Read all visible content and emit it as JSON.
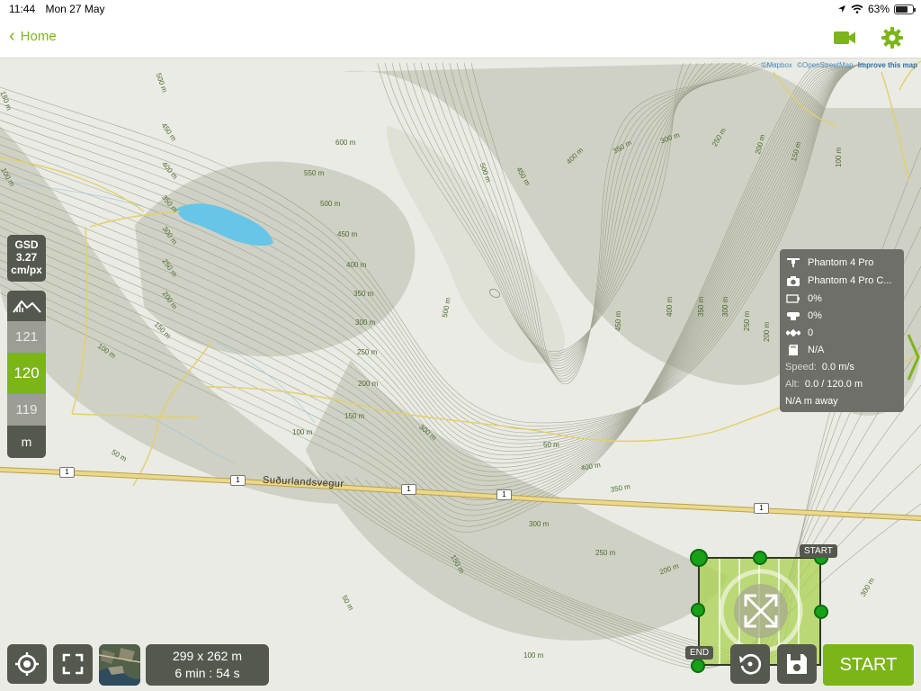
{
  "status_bar": {
    "time": "11:44",
    "date": "Mon 27 May",
    "battery": "63%"
  },
  "top_bar": {
    "back_label": "Home"
  },
  "map": {
    "attribution": {
      "mapbox": "©Mapbox",
      "osm": "©OpenStreetMap",
      "improve": "Improve this map"
    },
    "road_name": "Suðurlandsvegur",
    "road_shields": [
      "1",
      "1",
      "1",
      "1",
      "1"
    ],
    "contour_labels": [
      "500 m",
      "450 m",
      "400 m",
      "350 m",
      "300 m",
      "250 m",
      "200 m",
      "150 m",
      "100 m",
      "50 m",
      "600 m",
      "550 m",
      "500 m",
      "450 m",
      "400 m",
      "350 m",
      "300 m",
      "250 m",
      "200 m",
      "150 m",
      "100 m",
      "500 m",
      "450 m",
      "400 m",
      "350 m",
      "300 m",
      "250 m",
      "200 m",
      "150 m",
      "100 m",
      "500 m",
      "450 m",
      "400 m",
      "350 m",
      "300 m",
      "250 m",
      "200 m",
      "150 m",
      "100 m",
      "50 m",
      "400 m",
      "350 m",
      "300 m",
      "250 m",
      "200 m",
      "150 m",
      "100 m",
      "50 m",
      "300 m",
      "300 m"
    ]
  },
  "gsd": {
    "title": "GSD",
    "value": "3.27",
    "unit": "cm/px"
  },
  "altitude_selector": {
    "above": "121",
    "selected": "120",
    "below": "119",
    "unit": "m"
  },
  "drone_info": {
    "drone": "Phantom 4 Pro",
    "camera": "Phantom 4 Pro C...",
    "battery": "0%",
    "gimbal": "0%",
    "satellites": "0",
    "storage": "N/A",
    "speed_label": "Speed:",
    "speed": "0.0 m/s",
    "alt_label": "Alt:",
    "alt": "0.0 / 120.0 m",
    "distance": "N/A m away"
  },
  "flight_area": {
    "start_tag": "START",
    "end_tag": "END"
  },
  "bottom": {
    "dimensions": "299 x 262 m",
    "duration": "6 min : 54 s",
    "start_label": "START"
  },
  "colors": {
    "accent": "#7cb518",
    "panel": "#55584f",
    "lake": "#67c5e8",
    "road": "#e8d58a"
  }
}
